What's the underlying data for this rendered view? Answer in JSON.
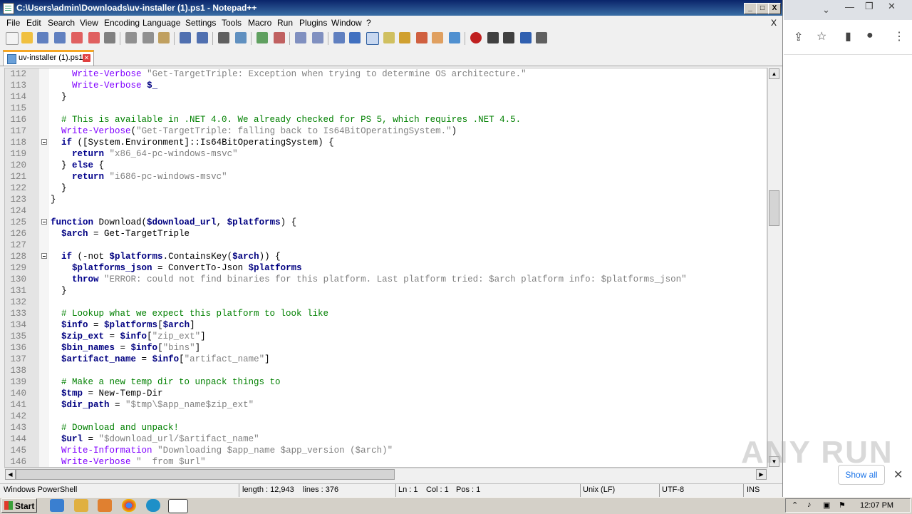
{
  "window": {
    "title": "C:\\Users\\admin\\Downloads\\uv-installer (1).ps1 - Notepad++",
    "minimize": "_",
    "maximize": "□",
    "close": "X"
  },
  "menu": [
    "File",
    "Edit",
    "Search",
    "View",
    "Encoding",
    "Language",
    "Settings",
    "Tools",
    "Macro",
    "Run",
    "Plugins",
    "Window",
    "?"
  ],
  "menu_close": "X",
  "tab": {
    "label": "uv-installer (1).ps1",
    "close": "✕"
  },
  "code_lines": [
    {
      "n": "112",
      "code": "    Write-Verbose \"Get-TargetTriple: Exception when trying to determine OS architecture.\""
    },
    {
      "n": "113",
      "code": "    Write-Verbose $_"
    },
    {
      "n": "114",
      "code": "  }"
    },
    {
      "n": "115",
      "code": ""
    },
    {
      "n": "116",
      "code": "  # This is available in .NET 4.0. We already checked for PS 5, which requires .NET 4.5."
    },
    {
      "n": "117",
      "code": "  Write-Verbose(\"Get-TargetTriple: falling back to Is64BitOperatingSystem.\")"
    },
    {
      "n": "118",
      "code": "  if ([System.Environment]::Is64BitOperatingSystem) {"
    },
    {
      "n": "119",
      "code": "    return \"x86_64-pc-windows-msvc\""
    },
    {
      "n": "120",
      "code": "  } else {"
    },
    {
      "n": "121",
      "code": "    return \"i686-pc-windows-msvc\""
    },
    {
      "n": "122",
      "code": "  }"
    },
    {
      "n": "123",
      "code": "}"
    },
    {
      "n": "124",
      "code": ""
    },
    {
      "n": "125",
      "code": "function Download($download_url, $platforms) {"
    },
    {
      "n": "126",
      "code": "  $arch = Get-TargetTriple"
    },
    {
      "n": "127",
      "code": ""
    },
    {
      "n": "128",
      "code": "  if (-not $platforms.ContainsKey($arch)) {"
    },
    {
      "n": "129",
      "code": "    $platforms_json = ConvertTo-Json $platforms"
    },
    {
      "n": "130",
      "code": "    throw \"ERROR: could not find binaries for this platform. Last platform tried: $arch platform info: $platforms_json\""
    },
    {
      "n": "131",
      "code": "  }"
    },
    {
      "n": "132",
      "code": ""
    },
    {
      "n": "133",
      "code": "  # Lookup what we expect this platform to look like"
    },
    {
      "n": "134",
      "code": "  $info = $platforms[$arch]"
    },
    {
      "n": "135",
      "code": "  $zip_ext = $info[\"zip_ext\"]"
    },
    {
      "n": "136",
      "code": "  $bin_names = $info[\"bins\"]"
    },
    {
      "n": "137",
      "code": "  $artifact_name = $info[\"artifact_name\"]"
    },
    {
      "n": "138",
      "code": ""
    },
    {
      "n": "139",
      "code": "  # Make a new temp dir to unpack things to"
    },
    {
      "n": "140",
      "code": "  $tmp = New-Temp-Dir"
    },
    {
      "n": "141",
      "code": "  $dir_path = \"$tmp\\$app_name$zip_ext\""
    },
    {
      "n": "142",
      "code": ""
    },
    {
      "n": "143",
      "code": "  # Download and unpack!"
    },
    {
      "n": "144",
      "code": "  $url = \"$download_url/$artifact_name\""
    },
    {
      "n": "145",
      "code": "  Write-Information \"Downloading $app_name $app_version ($arch)\""
    },
    {
      "n": "146",
      "code": "  Write-Verbose \"  from $url\""
    }
  ],
  "status": {
    "lang": "Windows PowerShell",
    "length": "length : 12,943",
    "lines": "lines : 376",
    "ln": "Ln : 1",
    "col": "Col : 1",
    "pos": "Pos : 1",
    "eol": "Unix (LF)",
    "enc": "UTF-8",
    "ins": "INS"
  },
  "browser": {
    "show_all": "Show all",
    "close": "✕",
    "watermark": "ANY RUN"
  },
  "taskbar": {
    "start": "Start",
    "clock": "12:07 PM"
  }
}
